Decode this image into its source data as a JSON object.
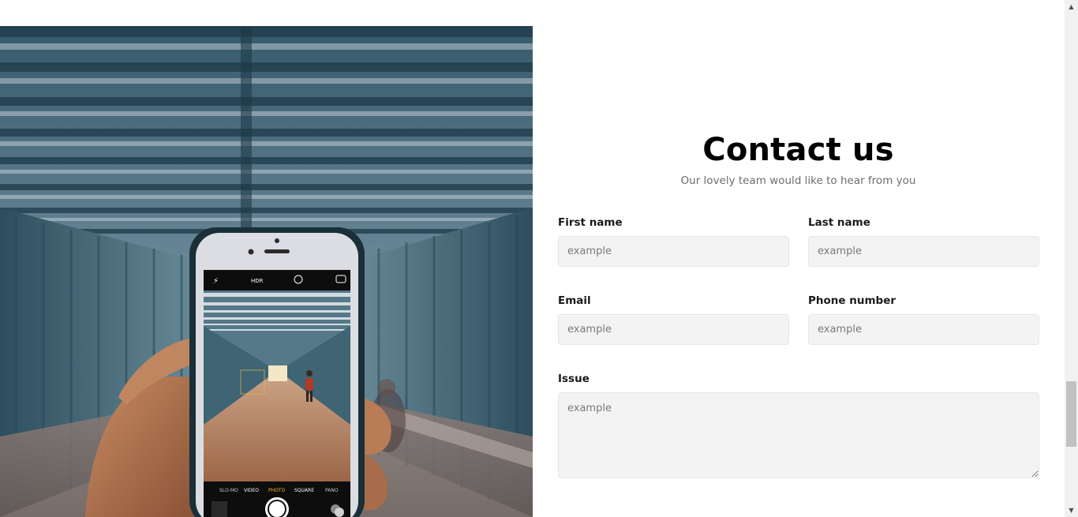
{
  "contact": {
    "title": "Contact us",
    "subtitle": "Our lovely team would like to hear from you",
    "fields": {
      "first_name": {
        "label": "First name",
        "placeholder": "example"
      },
      "last_name": {
        "label": "Last name",
        "placeholder": "example"
      },
      "email": {
        "label": "Email",
        "placeholder": "example"
      },
      "phone": {
        "label": "Phone number",
        "placeholder": "example"
      },
      "issue": {
        "label": "Issue",
        "placeholder": "example"
      }
    }
  },
  "photo": {
    "camera_flash": "⚡",
    "camera_hdr": "HDR",
    "camera_modes": [
      "SLO-MO",
      "VIDEO",
      "PHOTO",
      "SQUARE",
      "PANO"
    ]
  },
  "icons": {
    "scroll_up": "scroll-up-icon",
    "scroll_down": "scroll-down-icon"
  },
  "colors": {
    "input_bg": "#f3f3f3",
    "subtitle": "#6d6d6d",
    "active_mode": "#f5b532"
  }
}
